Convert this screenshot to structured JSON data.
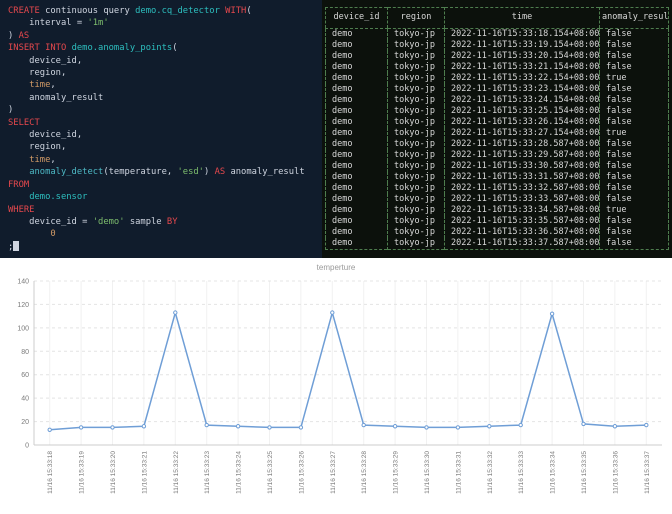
{
  "colors": {
    "editor_bg": "#101c2c",
    "editor_fg": "#cfd5e0",
    "keyword": "#e5484d",
    "string": "#7dbd6d",
    "entity": "#2dbfbf",
    "function": "#4db8c4",
    "number": "#d19a66",
    "terminal_bg": "#0c110c",
    "terminal_fg": "#d8d8d8",
    "table_border": "#4e7d4e",
    "chart_line": "#6f9ed6",
    "chart_grid": "#e4e4e4",
    "axis_label": "#7a7a7a",
    "chart_title": "#999999"
  },
  "editor": {
    "lines": [
      [
        {
          "t": "CREATE",
          "c": "kw"
        },
        {
          "t": " continuous query ",
          "c": "pl"
        },
        {
          "t": "demo.cq_detector",
          "c": "ty"
        },
        {
          "t": " ",
          "c": "pl"
        },
        {
          "t": "WITH",
          "c": "kw"
        },
        {
          "t": "(",
          "c": "pl"
        }
      ],
      [
        {
          "t": "    interval = ",
          "c": "pl"
        },
        {
          "t": "'1m'",
          "c": "st"
        }
      ],
      [
        {
          "t": ") ",
          "c": "pl"
        },
        {
          "t": "AS",
          "c": "kw"
        }
      ],
      [
        {
          "t": "INSERT INTO ",
          "c": "kw"
        },
        {
          "t": "demo.anomaly_points",
          "c": "ty"
        },
        {
          "t": "(",
          "c": "pl"
        }
      ],
      [
        {
          "t": "    device_id,",
          "c": "pl"
        }
      ],
      [
        {
          "t": "    region,",
          "c": "pl"
        }
      ],
      [
        {
          "t": "    ",
          "c": "pl"
        },
        {
          "t": "time",
          "c": "nu"
        },
        {
          "t": ",",
          "c": "pl"
        }
      ],
      [
        {
          "t": "    anomaly_result",
          "c": "pl"
        }
      ],
      [
        {
          "t": ")",
          "c": "pl"
        }
      ],
      [
        {
          "t": "SELECT",
          "c": "kw"
        }
      ],
      [
        {
          "t": "    device_id,",
          "c": "pl"
        }
      ],
      [
        {
          "t": "    region,",
          "c": "pl"
        }
      ],
      [
        {
          "t": "    ",
          "c": "pl"
        },
        {
          "t": "time",
          "c": "nu"
        },
        {
          "t": ",",
          "c": "pl"
        }
      ],
      [
        {
          "t": "    ",
          "c": "pl"
        },
        {
          "t": "anomaly_detect",
          "c": "fn"
        },
        {
          "t": "(temperature, ",
          "c": "pl"
        },
        {
          "t": "'esd'",
          "c": "st"
        },
        {
          "t": ") ",
          "c": "pl"
        },
        {
          "t": "AS",
          "c": "kw"
        },
        {
          "t": " anomaly_result",
          "c": "pl"
        }
      ],
      [
        {
          "t": "FROM",
          "c": "kw"
        }
      ],
      [
        {
          "t": "    ",
          "c": "pl"
        },
        {
          "t": "demo.sensor",
          "c": "ty"
        }
      ],
      [
        {
          "t": "WHERE",
          "c": "kw"
        }
      ],
      [
        {
          "t": "    device_id = ",
          "c": "pl"
        },
        {
          "t": "'demo'",
          "c": "st"
        },
        {
          "t": " sample ",
          "c": "pl"
        },
        {
          "t": "BY",
          "c": "kw"
        }
      ],
      [
        {
          "t": "        0",
          "c": "nu"
        }
      ],
      [
        {
          "t": ";",
          "c": "pl"
        }
      ]
    ]
  },
  "result_table": {
    "columns": [
      "device_id",
      "region",
      "time",
      "anomaly_result"
    ],
    "rows": [
      [
        "demo",
        "tokyo-jp",
        "2022-11-16T15:33:18.154+08:00",
        "false"
      ],
      [
        "demo",
        "tokyo-jp",
        "2022-11-16T15:33:19.154+08:00",
        "false"
      ],
      [
        "demo",
        "tokyo-jp",
        "2022-11-16T15:33:20.154+08:00",
        "false"
      ],
      [
        "demo",
        "tokyo-jp",
        "2022-11-16T15:33:21.154+08:00",
        "false"
      ],
      [
        "demo",
        "tokyo-jp",
        "2022-11-16T15:33:22.154+08:00",
        "true"
      ],
      [
        "demo",
        "tokyo-jp",
        "2022-11-16T15:33:23.154+08:00",
        "false"
      ],
      [
        "demo",
        "tokyo-jp",
        "2022-11-16T15:33:24.154+08:00",
        "false"
      ],
      [
        "demo",
        "tokyo-jp",
        "2022-11-16T15:33:25.154+08:00",
        "false"
      ],
      [
        "demo",
        "tokyo-jp",
        "2022-11-16T15:33:26.154+08:00",
        "false"
      ],
      [
        "demo",
        "tokyo-jp",
        "2022-11-16T15:33:27.154+08:00",
        "true"
      ],
      [
        "demo",
        "tokyo-jp",
        "2022-11-16T15:33:28.587+08:00",
        "false"
      ],
      [
        "demo",
        "tokyo-jp",
        "2022-11-16T15:33:29.587+08:00",
        "false"
      ],
      [
        "demo",
        "tokyo-jp",
        "2022-11-16T15:33:30.587+08:00",
        "false"
      ],
      [
        "demo",
        "tokyo-jp",
        "2022-11-16T15:33:31.587+08:00",
        "false"
      ],
      [
        "demo",
        "tokyo-jp",
        "2022-11-16T15:33:32.587+08:00",
        "false"
      ],
      [
        "demo",
        "tokyo-jp",
        "2022-11-16T15:33:33.587+08:00",
        "false"
      ],
      [
        "demo",
        "tokyo-jp",
        "2022-11-16T15:33:34.587+08:00",
        "true"
      ],
      [
        "demo",
        "tokyo-jp",
        "2022-11-16T15:33:35.587+08:00",
        "false"
      ],
      [
        "demo",
        "tokyo-jp",
        "2022-11-16T15:33:36.587+08:00",
        "false"
      ],
      [
        "demo",
        "tokyo-jp",
        "2022-11-16T15:33:37.587+08:00",
        "false"
      ]
    ]
  },
  "chart_data": {
    "type": "line",
    "title": "temperture",
    "x": [
      "11/16 15:33:18",
      "11/16 15:33:19",
      "11/16 15:33:20",
      "11/16 15:33:21",
      "11/16 15:33:22",
      "11/16 15:33:23",
      "11/16 15:33:24",
      "11/16 15:33:25",
      "11/16 15:33:26",
      "11/16 15:33:27",
      "11/16 15:33:28",
      "11/16 15:33:29",
      "11/16 15:33:30",
      "11/16 15:33:31",
      "11/16 15:33:32",
      "11/16 15:33:33",
      "11/16 15:33:34",
      "11/16 15:33:35",
      "11/16 15:33:36",
      "11/16 15:33:37"
    ],
    "series": [
      {
        "name": "temperture",
        "values": [
          13,
          15,
          15,
          16,
          113,
          17,
          16,
          15,
          15,
          113,
          17,
          16,
          15,
          15,
          16,
          17,
          112,
          18,
          16,
          17
        ]
      }
    ],
    "xlabel": "",
    "ylabel": "",
    "ylim": [
      0,
      140
    ],
    "y_ticks": [
      0,
      20,
      40,
      60,
      80,
      100,
      120,
      140
    ],
    "grid": true,
    "legend": "none"
  }
}
